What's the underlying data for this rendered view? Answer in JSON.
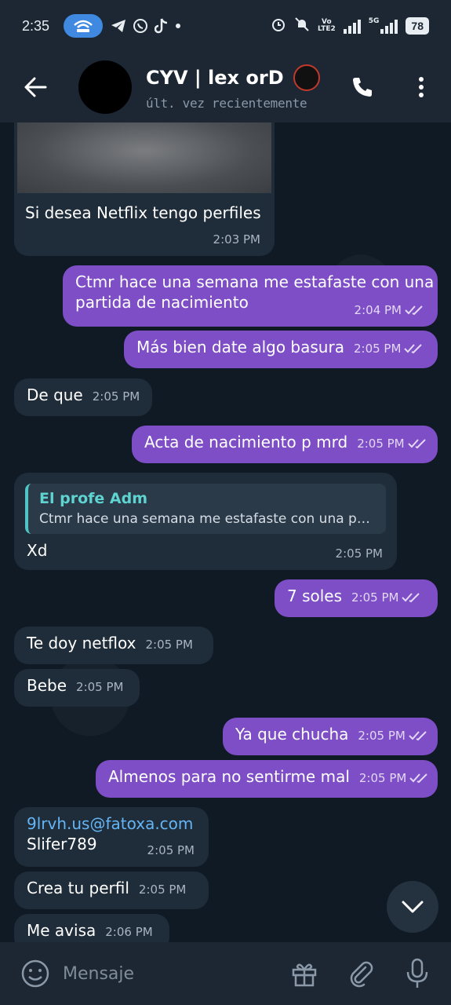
{
  "status_bar": {
    "time": "2:35",
    "network_tags": [
      "Vo",
      "LTE2"
    ],
    "fiveg": "5G",
    "battery": "78",
    "icons": [
      "hotspot-icon",
      "telegram-icon",
      "whatsapp-icon",
      "tiktok-icon",
      "dot-icon",
      "alarm-icon",
      "mute-icon",
      "signal-icon"
    ]
  },
  "header": {
    "title": "CYV | lex orD",
    "status": "últ. vez recientemente"
  },
  "messages": [
    {
      "dir": "in",
      "text": "Si desea Netflix tengo perfiles",
      "time": "2:03 PM"
    },
    {
      "dir": "out",
      "text_line1": "Ctmr hace una semana me estafaste con una",
      "text_line2": "partida de nacimiento",
      "time": "2:04 PM"
    },
    {
      "dir": "out",
      "text": "Más bien date algo basura",
      "time": "2:05 PM"
    },
    {
      "dir": "in",
      "text": "De que",
      "time": "2:05 PM"
    },
    {
      "dir": "out",
      "text": "Acta de nacimiento p mrd",
      "time": "2:05 PM"
    },
    {
      "dir": "in",
      "reply_name": "El profe Adm",
      "reply_text": "Ctmr hace una semana me estafaste con una pa…",
      "text": "Xd",
      "time": "2:05 PM"
    },
    {
      "dir": "out",
      "text": "7 soles",
      "time": "2:05 PM"
    },
    {
      "dir": "in",
      "text": "Te doy netflox",
      "time": "2:05 PM"
    },
    {
      "dir": "in",
      "text": "Bebe",
      "time": "2:05 PM"
    },
    {
      "dir": "out",
      "text": "Ya que chucha",
      "time": "2:05 PM"
    },
    {
      "dir": "out",
      "text": "Almenos para no sentirme mal",
      "time": "2:05 PM"
    },
    {
      "dir": "in",
      "email": "9lrvh.us@fatoxa.com",
      "text": "Slifer789",
      "time": "2:05 PM"
    },
    {
      "dir": "in",
      "text": "Crea tu perfil",
      "time": "2:05 PM"
    },
    {
      "dir": "in",
      "text": "Me avisa",
      "time": "2:06 PM"
    }
  ],
  "input": {
    "placeholder": "Mensaje"
  },
  "colors": {
    "outgoing_bubble": "#7d4ec6",
    "incoming_bubble": "#1f2c39",
    "header_bg": "#1c2733",
    "reply_accent": "#4fc3c6"
  }
}
